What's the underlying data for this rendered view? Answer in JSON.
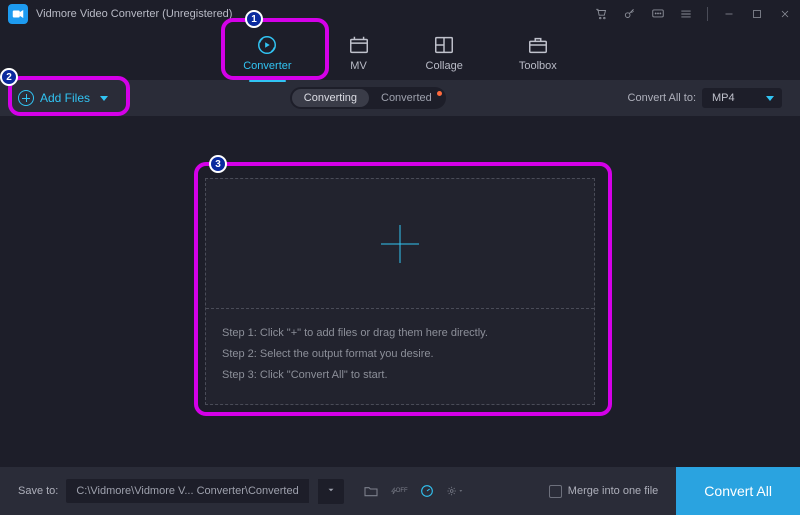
{
  "app": {
    "title": "Vidmore Video Converter (Unregistered)"
  },
  "nav": {
    "items": [
      {
        "label": "Converter"
      },
      {
        "label": "MV"
      },
      {
        "label": "Collage"
      },
      {
        "label": "Toolbox"
      }
    ]
  },
  "toolbar": {
    "add_files_label": "Add Files",
    "sub_converting": "Converting",
    "sub_converted": "Converted",
    "convert_all_to_label": "Convert All to:",
    "format_value": "MP4"
  },
  "dropzone": {
    "step1": "Step 1: Click \"+\" to add files or drag them here directly.",
    "step2": "Step 2: Select the output format you desire.",
    "step3": "Step 3: Click \"Convert All\" to start."
  },
  "bottombar": {
    "save_to_label": "Save to:",
    "path_value": "C:\\Vidmore\\Vidmore V... Converter\\Converted",
    "merge_label": "Merge into one file",
    "convert_button": "Convert All"
  },
  "annotations": {
    "b1": "1",
    "b2": "2",
    "b3": "3"
  }
}
